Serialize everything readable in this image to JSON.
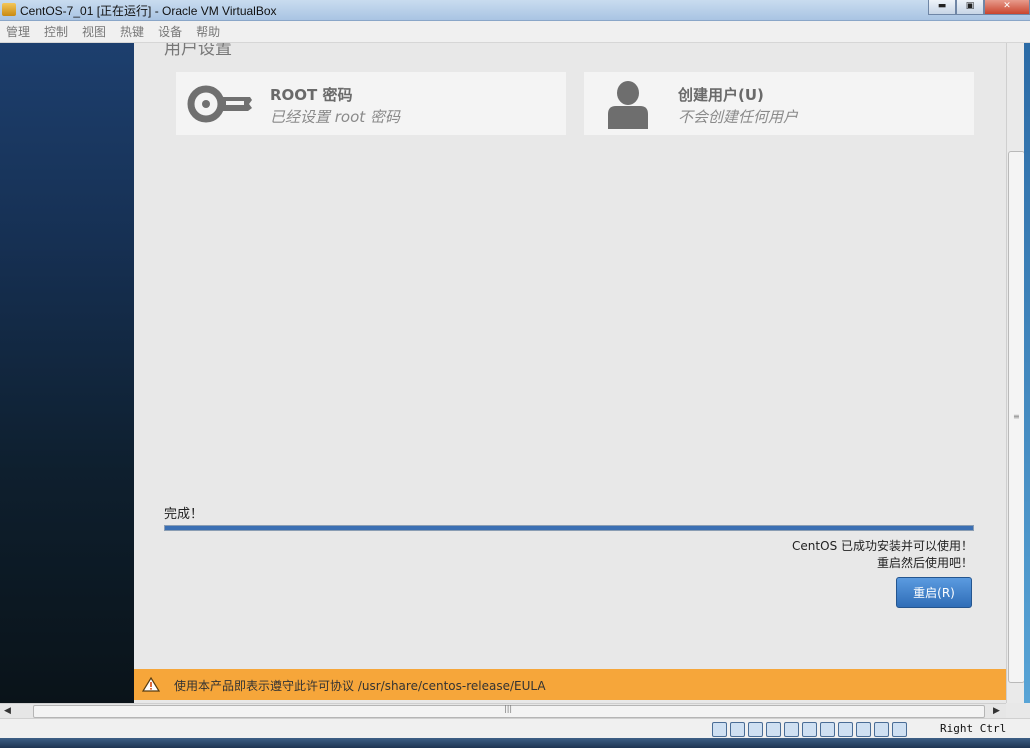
{
  "window": {
    "title": "CentOS-7_01 [正在运行] - Oracle VM VirtualBox",
    "buttons": [
      "▬",
      "▣",
      "✕"
    ]
  },
  "menu": [
    "管理",
    "控制",
    "视图",
    "热键",
    "设备",
    "帮助"
  ],
  "section_title": "用户设置",
  "cards": [
    {
      "title": "ROOT 密码",
      "subtitle": "已经设置 root 密码",
      "icon": "key-icon"
    },
    {
      "title": "创建用户(U)",
      "subtitle": "不会创建任何用户",
      "icon": "user-icon"
    }
  ],
  "status": {
    "label": "完成！",
    "progress_percent": 100,
    "message_line1": "CentOS 已成功安装并可以使用！",
    "message_line2": "重启然后使用吧！",
    "reboot_button": "重启(R)"
  },
  "eula": {
    "text": "使用本产品即表示遵守此许可协议 /usr/share/centos-release/EULA",
    "icon": "warning-icon"
  },
  "statusbar": {
    "host_key": "Right Ctrl",
    "icons": [
      "hdd-icon",
      "optical-icon",
      "usb-icon",
      "network-icon",
      "pencil-icon",
      "folder-icon",
      "display-icon",
      "video-icon",
      "cpu-icon",
      "mouse-icon",
      "capture-icon"
    ]
  },
  "colors": {
    "accent": "#3b6fb3",
    "eula_bar": "#f6a63a",
    "button": "#3a78c4"
  }
}
